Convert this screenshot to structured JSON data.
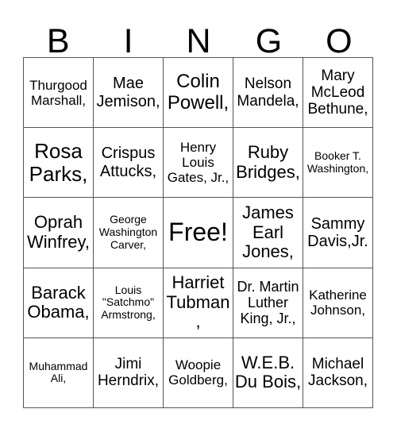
{
  "header": {
    "letters": [
      "B",
      "I",
      "N",
      "G",
      "O"
    ]
  },
  "card": {
    "rows": [
      [
        "Thurgood Marshall,",
        "Mae Jemison,",
        "Colin Powell,",
        "Nelson Mandela,",
        "Mary McLeod Bethune,"
      ],
      [
        "Rosa Parks,",
        "Crispus Attucks,",
        "Henry Louis Gates, Jr.,",
        "Ruby Bridges,",
        "Booker T. Washington,"
      ],
      [
        "Oprah Winfrey,",
        "George Washington Carver,",
        "Free!",
        "James Earl Jones,",
        "Sammy Davis,Jr."
      ],
      [
        "Barack Obama,",
        "Louis \"Satchmo\" Armstrong,",
        "Harriet Tubman,",
        "Dr. Martin Luther King, Jr.,",
        "Katherine Johnson,"
      ],
      [
        "Muhammad Ali,",
        "Jimi Herndrix,",
        "Woopie Goldberg,",
        "W.E.B. Du Bois,",
        "Michael Jackson,"
      ]
    ]
  }
}
